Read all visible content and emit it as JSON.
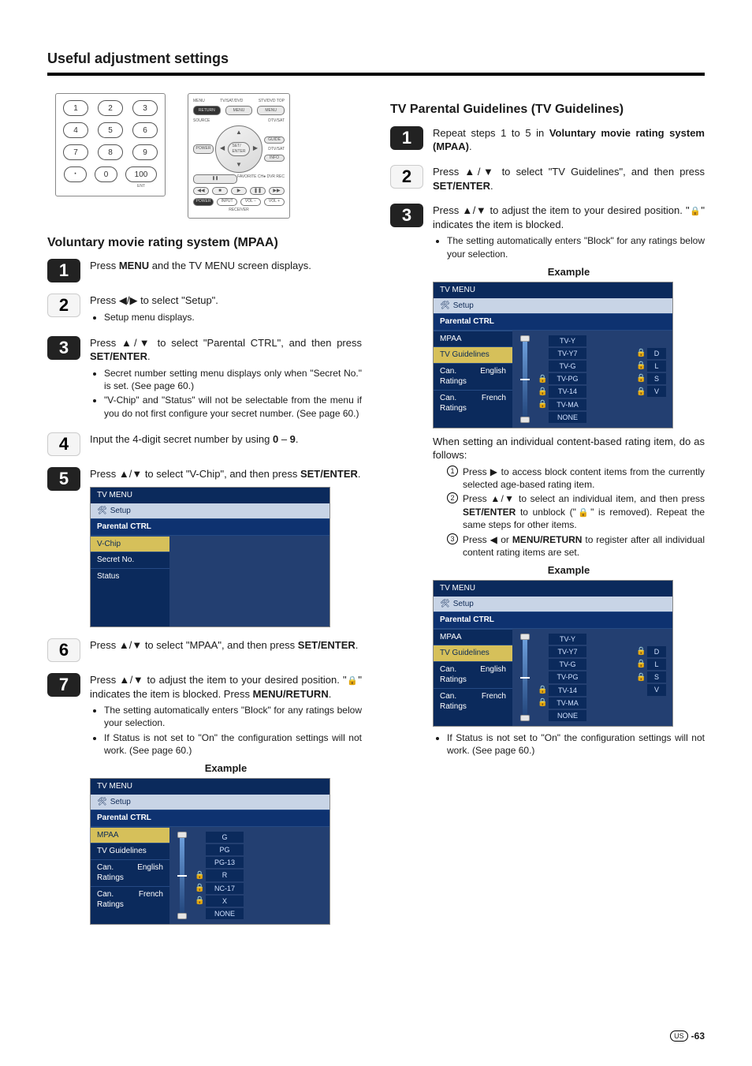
{
  "page": {
    "title": "Useful adjustment settings",
    "number_prefix": "US",
    "number": "-63"
  },
  "remote": {
    "numpad": {
      "keys": [
        "1",
        "2",
        "3",
        "4",
        "5",
        "6",
        "7",
        "8",
        "9",
        "·",
        "0",
        "100"
      ],
      "ent_label": "ENT"
    },
    "navpad": {
      "row1_labels": [
        "MENU",
        "TV/SAT/DVD",
        "STV/DVD TOP"
      ],
      "row1_buttons": [
        "RETURN",
        "MENU",
        "MENU"
      ],
      "row2_labels": [
        "SOURCE",
        "",
        "DTV/SAT"
      ],
      "row2_buttons": [
        "POWER",
        "",
        "GUIDE"
      ],
      "right_labels": [
        "DTV/SAT",
        "INFO"
      ],
      "center": "SET/\\nENTER",
      "fav_label": "FAVORITE CH",
      "rec_label": "● DVR REC",
      "transport": [
        "◀◀",
        "■",
        "▶",
        "❚❚",
        "▶▶"
      ],
      "bottom": [
        "POWER",
        "INPUT",
        "VOL −",
        "VOL +"
      ],
      "receiver_label": "RECEIVER"
    }
  },
  "left": {
    "heading": "Voluntary movie rating system (MPAA)",
    "steps": {
      "1": {
        "text_a": "Press ",
        "bold_a": "MENU",
        "text_b": " and the TV MENU screen displays."
      },
      "2": {
        "text_a": "Press ",
        "sym": "◀/▶",
        "text_b": " to select \"Setup\".",
        "bullets": [
          "Setup menu displays."
        ]
      },
      "3": {
        "text_a": "Press ",
        "sym": "▲/▼",
        "text_b": " to select \"Parental CTRL\", and then press ",
        "bold_b": "SET/ENTER",
        "text_c": ".",
        "bullets": [
          "Secret number setting menu displays only when \"Secret No.\" is set. (See page 60.)",
          "\"V-Chip\" and \"Status\" will not be selectable from the menu if you do not first configure your secret number. (See page 60.)"
        ]
      },
      "4": {
        "text_a": "Input the 4-digit secret number by using ",
        "bold_a": "0",
        "text_b": " – ",
        "bold_b": "9",
        "text_c": "."
      },
      "5": {
        "text_a": "Press ",
        "sym": "▲/▼",
        "text_b": " to select \"V-Chip\", and then press ",
        "bold_b": "SET/ENTER",
        "text_c": "."
      },
      "6": {
        "text_a": "Press ",
        "sym": "▲/▼",
        "text_b": " to select \"MPAA\", and then press ",
        "bold_b": "SET/ENTER",
        "text_c": "."
      },
      "7": {
        "text_a": "Press ",
        "sym": "▲/▼",
        "text_b": " to adjust the item to your desired position. \"",
        "after_lock": "\" indicates the item is blocked. Press ",
        "bold_b": "MENU/RETURN",
        "text_c": ".",
        "bullets": [
          "The setting automatically enters \"Block\" for any ratings below your selection.",
          "If Status is not set to \"On\" the configuration settings will not work. (See page 60.)"
        ]
      }
    },
    "menu5": {
      "title": "TV MENU",
      "tab": "Setup",
      "hdr": "Parental CTRL",
      "sidebar": [
        "V-Chip",
        "Secret No.",
        "Status"
      ],
      "highlight_index": 0
    },
    "example_label": "Example",
    "menu7": {
      "title": "TV MENU",
      "tab": "Setup",
      "hdr": "Parental CTRL",
      "sidebar": [
        "MPAA",
        "TV Guidelines",
        "Can. English Ratings",
        "Can. French Ratings"
      ],
      "highlight_index": 0,
      "ratings": [
        {
          "lock": false,
          "label": "G"
        },
        {
          "lock": false,
          "label": "PG"
        },
        {
          "lock": false,
          "label": "PG-13"
        },
        {
          "lock": true,
          "label": "R"
        },
        {
          "lock": true,
          "label": "NC-17"
        },
        {
          "lock": true,
          "label": "X"
        },
        {
          "lock": false,
          "label": "NONE"
        }
      ]
    }
  },
  "right": {
    "heading": "TV Parental Guidelines (TV Guidelines)",
    "steps": {
      "1": {
        "text_a": "Repeat steps 1 to 5 in ",
        "bold_a": "Voluntary movie rating system (MPAA)",
        "text_b": "."
      },
      "2": {
        "text_a": "Press ",
        "sym": "▲/▼",
        "text_b": " to select \"TV Guidelines\", and then press ",
        "bold_b": "SET/ENTER",
        "text_c": "."
      },
      "3": {
        "text_a": "Press ",
        "sym": "▲/▼",
        "text_b": " to adjust the item to your desired position. \"",
        "after_lock": "\" indicates the item is blocked.",
        "bullets": [
          "The setting automatically enters \"Block\" for any ratings below your selection."
        ]
      }
    },
    "example_label": "Example",
    "menuA": {
      "title": "TV MENU",
      "tab": "Setup",
      "hdr": "Parental CTRL",
      "sidebar": [
        "MPAA",
        "TV Guidelines",
        "Can. English Ratings",
        "Can. French Ratings"
      ],
      "highlight_index": 1,
      "ratings_left": [
        {
          "lock": false,
          "label": "TV-Y"
        },
        {
          "lock": false,
          "label": "TV-Y7"
        },
        {
          "lock": false,
          "label": "TV-G"
        },
        {
          "lock": true,
          "label": "TV-PG"
        },
        {
          "lock": true,
          "label": "TV-14"
        },
        {
          "lock": true,
          "label": "TV-MA"
        },
        {
          "lock": false,
          "label": "NONE"
        }
      ],
      "ratings_right": [
        {
          "lock": true,
          "label": "D"
        },
        {
          "lock": true,
          "label": "L"
        },
        {
          "lock": true,
          "label": "S"
        },
        {
          "lock": true,
          "label": "V"
        }
      ]
    },
    "mid_text": "When setting an individual content-based rating item, do as follows:",
    "clist": {
      "1": {
        "pre": "Press ",
        "sym": "▶",
        "post": " to access block content items from the currently selected age-based rating item."
      },
      "2": {
        "pre": "Press ",
        "sym": "▲/▼",
        "mid": " to select an individual item, and then press ",
        "bold": "SET/ENTER",
        "post2": " to unblock (\"",
        "post3": "\" is removed). Repeat the same steps for other items."
      },
      "3": {
        "pre": "Press ",
        "sym": "◀",
        "mid": " or ",
        "bold": "MENU/RETURN",
        "post2": " to register after all individual content rating items are set."
      }
    },
    "menuB": {
      "title": "TV MENU",
      "tab": "Setup",
      "hdr": "Parental CTRL",
      "sidebar": [
        "MPAA",
        "TV Guidelines",
        "Can. English Ratings",
        "Can. French Ratings"
      ],
      "highlight_index": 1,
      "ratings_left": [
        {
          "lock": false,
          "label": "TV-Y"
        },
        {
          "lock": false,
          "label": "TV-Y7"
        },
        {
          "lock": false,
          "label": "TV-G"
        },
        {
          "lock": false,
          "label": "TV-PG"
        },
        {
          "lock": true,
          "label": "TV-14"
        },
        {
          "lock": true,
          "label": "TV-MA"
        },
        {
          "lock": false,
          "label": "NONE"
        }
      ],
      "ratings_right": [
        {
          "lock": true,
          "label": "D"
        },
        {
          "lock": true,
          "label": "L"
        },
        {
          "lock": true,
          "label": "S"
        },
        {
          "lock": false,
          "label": "V"
        }
      ]
    },
    "final_bullet": "If Status is not set to \"On\" the configuration settings will not work. (See page 60.)"
  }
}
